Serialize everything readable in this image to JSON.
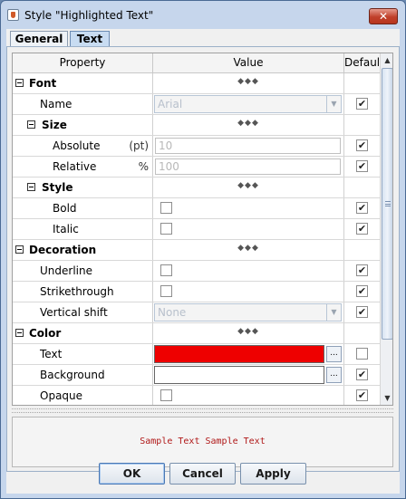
{
  "window": {
    "title": "Style \"Highlighted Text\"",
    "close_glyph": "✕",
    "app_icon": "java-cup-icon"
  },
  "tabs": [
    {
      "label": "General",
      "selected": false
    },
    {
      "label": "Text",
      "selected": true
    }
  ],
  "table": {
    "columns": [
      "Property",
      "Value",
      "Default"
    ],
    "rows": [
      {
        "label": "Font",
        "kind": "group",
        "level": 0,
        "value": "◆◆◆"
      },
      {
        "label": "Name",
        "kind": "combo",
        "level": 1,
        "value": "Arial",
        "default": true
      },
      {
        "label": "Size",
        "kind": "group",
        "level": 1,
        "value": "◆◆◆"
      },
      {
        "label": "Absolute",
        "unit": "(pt)",
        "kind": "text",
        "level": 2,
        "value": "10",
        "default": true
      },
      {
        "label": "Relative",
        "unit": "%",
        "kind": "text",
        "level": 2,
        "value": "100",
        "default": true
      },
      {
        "label": "Style",
        "kind": "group",
        "level": 1,
        "value": "◆◆◆"
      },
      {
        "label": "Bold",
        "kind": "check",
        "level": 2,
        "value": false,
        "default": true
      },
      {
        "label": "Italic",
        "kind": "check",
        "level": 2,
        "value": false,
        "default": true
      },
      {
        "label": "Decoration",
        "kind": "group",
        "level": 0,
        "value": "◆◆◆"
      },
      {
        "label": "Underline",
        "kind": "check",
        "level": 1,
        "value": false,
        "default": true
      },
      {
        "label": "Strikethrough",
        "kind": "check",
        "level": 1,
        "value": false,
        "default": true
      },
      {
        "label": "Vertical shift",
        "kind": "combo",
        "level": 1,
        "value": "None",
        "default": true
      },
      {
        "label": "Color",
        "kind": "group",
        "level": 0,
        "value": "◆◆◆"
      },
      {
        "label": "Text",
        "kind": "color",
        "level": 1,
        "color": "#ee0000",
        "button": "...",
        "default": false
      },
      {
        "label": "Background",
        "kind": "color",
        "level": 1,
        "color": "#ffffff",
        "button": "...",
        "default": true
      },
      {
        "label": "Opaque",
        "kind": "check",
        "level": 1,
        "value": false,
        "default": true
      }
    ]
  },
  "preview": {
    "text": "Sample Text Sample Text",
    "color": "#b01818"
  },
  "buttons": {
    "ok": "OK",
    "cancel": "Cancel",
    "apply": "Apply"
  }
}
